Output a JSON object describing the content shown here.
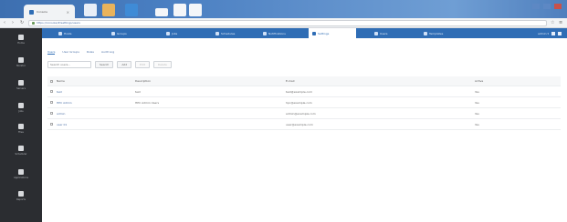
{
  "browser": {
    "tab_title": "Console",
    "tab_close": "×",
    "address": "https://console/#/settings/users",
    "nav_back": "‹",
    "nav_forward": "›",
    "nav_reload": "↻",
    "window_controls": [
      "—",
      "☐",
      "✕"
    ]
  },
  "sidebar": {
    "items": [
      {
        "label": "Home",
        "icon": "home-icon"
      },
      {
        "label": "Monitor",
        "icon": "monitor-icon"
      },
      {
        "label": "Servers",
        "icon": "server-icon"
      },
      {
        "label": "Jobs",
        "icon": "jobs-icon"
      },
      {
        "label": "Files",
        "icon": "folder-icon"
      },
      {
        "label": "Scheduler",
        "icon": "clock-icon"
      },
      {
        "label": "Applications",
        "icon": "apps-icon"
      },
      {
        "label": "Reports",
        "icon": "reports-icon"
      }
    ]
  },
  "topnav": {
    "tabs": [
      {
        "label": "Hosts",
        "active": false
      },
      {
        "label": "Groups",
        "active": false
      },
      {
        "label": "Jobs",
        "active": false
      },
      {
        "label": "Schedules",
        "active": false
      },
      {
        "label": "Notifications",
        "active": false
      },
      {
        "label": "Settings",
        "active": true
      },
      {
        "label": "Users",
        "active": false
      },
      {
        "label": "Templates",
        "active": false
      }
    ],
    "user": "admin ▾"
  },
  "subtabs": [
    "Users",
    "User Groups",
    "Roles",
    "Audit Log"
  ],
  "actions": {
    "search_placeholder": "Search users...",
    "buttons": [
      "Search",
      "Add",
      "Edit",
      "Delete"
    ]
  },
  "table": {
    "headers": [
      "Name",
      "Description",
      "E-mail",
      "Active"
    ],
    "rows": [
      {
        "name": "test",
        "description": "test",
        "email": "test@example.com",
        "active": "Yes"
      },
      {
        "name": "HPC Admin",
        "description": "HPC Admin Users",
        "email": "hpc@example.com",
        "active": "Yes"
      },
      {
        "name": "admin",
        "description": "",
        "email": "admin@example.com",
        "active": "Yes"
      },
      {
        "name": "user 01",
        "description": "",
        "email": "user@example.com",
        "active": "Yes"
      }
    ]
  },
  "colors": {
    "accent": "#2f6db5",
    "sidebar": "#2b2d31"
  }
}
